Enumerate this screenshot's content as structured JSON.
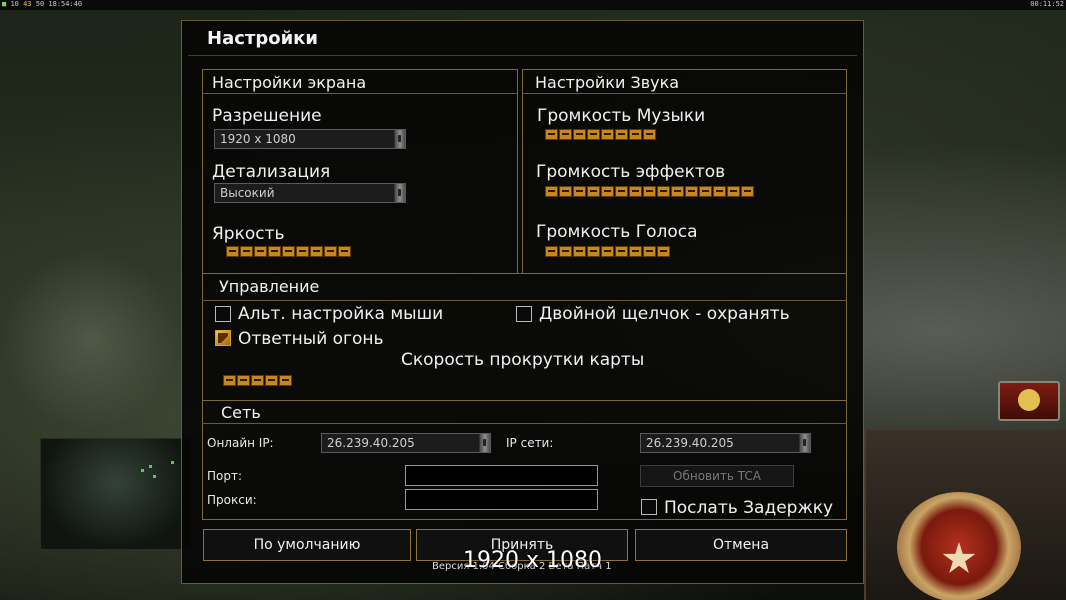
{
  "hud": {
    "left_1": "10",
    "left_2": "43",
    "left_3": "50",
    "left_time": "18:54:40",
    "right_time": "00:11:52"
  },
  "dialog": {
    "title": "Настройки",
    "display": {
      "title": "Настройки экрана",
      "resolution_label": "Разрешение",
      "resolution_value": "1920 x 1080",
      "detail_label": "Детализация",
      "detail_value": "Высокий",
      "brightness_label": "Яркость",
      "brightness_segments": 9
    },
    "sound": {
      "title": "Настройки Звука",
      "music_label": "Громкость Музыки",
      "music_segments": 8,
      "effects_label": "Громкость эффектов",
      "effects_segments": 15,
      "voice_label": "Громкость Голоса",
      "voice_segments": 9
    },
    "controls": {
      "title": "Управление",
      "alt_mouse_label": "Альт. настройка мыши",
      "alt_mouse_checked": false,
      "double_click_label": "Двойной щелчок - охранять",
      "double_click_checked": false,
      "return_fire_label": "Ответный огонь",
      "return_fire_checked": true,
      "scroll_speed_label": "Скорость прокрутки карты",
      "scroll_speed_segments": 5
    },
    "network": {
      "title": "Сеть",
      "online_ip_label": "Онлайн IP:",
      "online_ip_value": "26.239.40.205",
      "lan_ip_label": "IP сети:",
      "lan_ip_value": "26.239.40.205",
      "port_label": "Порт:",
      "port_value": "",
      "proxy_label": "Прокси:",
      "proxy_value": "",
      "update_tca_label": "Обновить TCA",
      "send_delay_label": "Послать Задержку",
      "send_delay_checked": false
    },
    "buttons": {
      "defaults": "По умолчанию",
      "accept": "Принять",
      "cancel": "Отмена"
    },
    "version_text": "Версия 1.04  Сборка 2  Бета  Патч 1"
  },
  "overlay_resolution": "1920 x 1080",
  "colors": {
    "accent_gold": "#c88719",
    "border_gold": "#7c6a3c",
    "dialog_bg": "#060604"
  }
}
